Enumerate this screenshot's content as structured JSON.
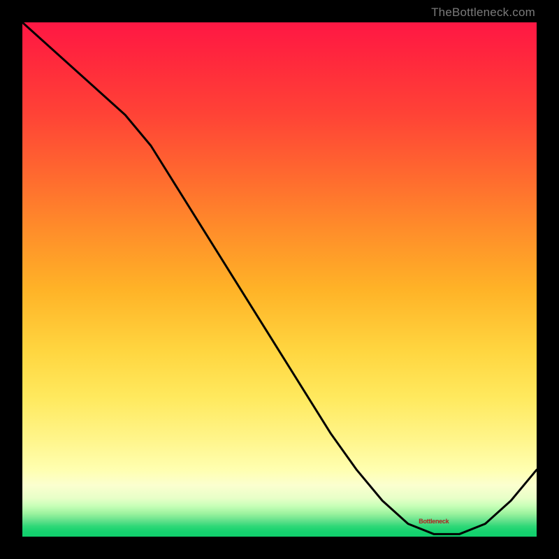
{
  "watermark": "TheBottleneck.com",
  "annotation_label": "Bottleneck",
  "chart_data": {
    "type": "line",
    "title": "",
    "xlabel": "",
    "ylabel": "",
    "xlim": [
      0,
      100
    ],
    "ylim": [
      0,
      100
    ],
    "grid": false,
    "legend": false,
    "annotations": [
      {
        "label": "Bottleneck",
        "x": 80,
        "y": 3
      }
    ],
    "series": [
      {
        "name": "bottleneck-curve",
        "x": [
          0,
          5,
          10,
          15,
          20,
          25,
          30,
          35,
          40,
          45,
          50,
          55,
          60,
          65,
          70,
          75,
          80,
          85,
          90,
          95,
          100
        ],
        "values": [
          100,
          95.5,
          91,
          86.5,
          82,
          76,
          68,
          60,
          52,
          44,
          36,
          28,
          20,
          13,
          7,
          2.5,
          0.5,
          0.5,
          2.5,
          7,
          13
        ]
      }
    ]
  },
  "colors": {
    "line": "#000000",
    "annotation": "#b42a25",
    "frame": "#000000"
  }
}
